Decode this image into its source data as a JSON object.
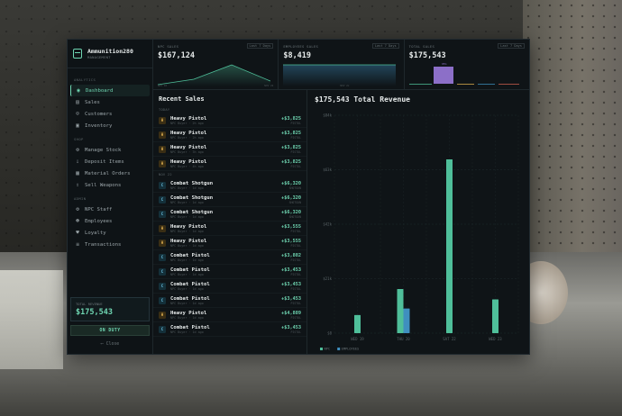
{
  "app": {
    "title": "Ammunition280",
    "subtitle": "MANAGEMENT"
  },
  "nav": {
    "sections": [
      {
        "label": "ANALYTICS",
        "items": [
          {
            "label": "Dashboard",
            "icon": "dashboard-icon",
            "active": true
          },
          {
            "label": "Sales",
            "icon": "sales-icon"
          },
          {
            "label": "Customers",
            "icon": "customers-icon"
          },
          {
            "label": "Inventory",
            "icon": "inventory-icon"
          }
        ]
      },
      {
        "label": "SHOP",
        "items": [
          {
            "label": "Manage Stock",
            "icon": "stock-icon"
          },
          {
            "label": "Deposit Items",
            "icon": "deposit-icon"
          },
          {
            "label": "Material Orders",
            "icon": "orders-icon"
          },
          {
            "label": "Sell Weapons",
            "icon": "sell-icon"
          }
        ]
      },
      {
        "label": "ADMIN",
        "items": [
          {
            "label": "NPC Staff",
            "icon": "npc-icon"
          },
          {
            "label": "Employees",
            "icon": "employees-icon"
          },
          {
            "label": "Loyalty",
            "icon": "loyalty-icon"
          },
          {
            "label": "Transactions",
            "icon": "transactions-icon"
          }
        ]
      }
    ]
  },
  "footer": {
    "revenue_label": "TOTAL REVENUE",
    "revenue_value": "$175,543",
    "duty_label": "ON DUTY",
    "close_label": "Close"
  },
  "stats": {
    "npc": {
      "label": "NPC SALES",
      "tag": "Last 7 Days",
      "value": "$167,124",
      "axis_start": "NOV 18",
      "axis_end": "NOV 22"
    },
    "employees": {
      "label": "EMPLOYEES SALES",
      "tag": "Last 7 Days",
      "value": "$8,419",
      "axis_end": "NOV 2x"
    },
    "total": {
      "label": "TOTAL SALES",
      "tag": "Last 7 Days",
      "value": "$175,543",
      "bar_label": "95%"
    }
  },
  "colors": {
    "accent": "#6fd6b2",
    "npc": "#4fbf9a",
    "employee": "#3f8fbf",
    "purple": "#8c6fc8"
  },
  "sales": {
    "title": "Recent Sales",
    "groups": [
      {
        "label": "TODAY",
        "rows": [
          {
            "name": "Heavy Pistol",
            "meta": "NPC Buyer · 2h ago",
            "amount": "+$3,825",
            "sub": "PISTOL",
            "kind": "pistol"
          },
          {
            "name": "Heavy Pistol",
            "meta": "NPC Buyer · 2h ago",
            "amount": "+$3,825",
            "sub": "PISTOL",
            "kind": "pistol"
          },
          {
            "name": "Heavy Pistol",
            "meta": "NPC Buyer · 3h ago",
            "amount": "+$3,825",
            "sub": "PISTOL",
            "kind": "pistol"
          },
          {
            "name": "Heavy Pistol",
            "meta": "NPC Buyer · 4h ago",
            "amount": "+$3,825",
            "sub": "PISTOL",
            "kind": "pistol"
          }
        ]
      },
      {
        "label": "NOV 22",
        "rows": [
          {
            "name": "Combat Shotgun",
            "meta": "NPC Buyer · 1d ago",
            "amount": "+$6,320",
            "sub": "SHOTGUN",
            "kind": "shotgun"
          },
          {
            "name": "Combat Shotgun",
            "meta": "NPC Buyer · 1d ago",
            "amount": "+$6,320",
            "sub": "SHOTGUN",
            "kind": "shotgun"
          },
          {
            "name": "Combat Shotgun",
            "meta": "NPC Buyer · 1d ago",
            "amount": "+$6,320",
            "sub": "SHOTGUN",
            "kind": "shotgun"
          },
          {
            "name": "Heavy Pistol",
            "meta": "NPC Buyer · 1d ago",
            "amount": "+$3,555",
            "sub": "PISTOL",
            "kind": "pistol"
          },
          {
            "name": "Heavy Pistol",
            "meta": "NPC Buyer · 1d ago",
            "amount": "+$3,555",
            "sub": "PISTOL",
            "kind": "pistol"
          },
          {
            "name": "Combat Pistol",
            "meta": "NPC Buyer · 1d ago",
            "amount": "+$3,802",
            "sub": "PISTOL",
            "kind": "shotgun"
          },
          {
            "name": "Combat Pistol",
            "meta": "NPC Buyer · 1d ago",
            "amount": "+$3,453",
            "sub": "PISTOL",
            "kind": "shotgun"
          },
          {
            "name": "Combat Pistol",
            "meta": "NPC Buyer · 1d ago",
            "amount": "+$3,453",
            "sub": "PISTOL",
            "kind": "shotgun"
          },
          {
            "name": "Combat Pistol",
            "meta": "NPC Buyer · 1d ago",
            "amount": "+$3,453",
            "sub": "PISTOL",
            "kind": "shotgun"
          },
          {
            "name": "Heavy Pistol",
            "meta": "NPC Buyer · 1d ago",
            "amount": "+$4,889",
            "sub": "PISTOL",
            "kind": "pistol"
          },
          {
            "name": "Combat Pistol",
            "meta": "NPC Buyer · 1d ago",
            "amount": "+$3,453",
            "sub": "PISTOL",
            "kind": "shotgun"
          }
        ]
      }
    ]
  },
  "revenue": {
    "title": "$175,543 Total Revenue"
  },
  "chart_data": {
    "type": "bar",
    "categories": [
      "WED 19",
      "THU 20",
      "SAT 22",
      "WED 23"
    ],
    "series": [
      {
        "name": "NPC",
        "values": [
          7000,
          17000,
          67000,
          13000
        ],
        "color": "#4fbf9a"
      },
      {
        "name": "EMPLOYEES",
        "values": [
          0,
          9500,
          0,
          0
        ],
        "color": "#3f8fbf"
      }
    ],
    "ylim": [
      0,
      84000
    ],
    "yticks": [
      "$0",
      "$21k",
      "$42k",
      "$63k",
      "$84k"
    ],
    "grid": true,
    "legend": "bottom-left"
  }
}
